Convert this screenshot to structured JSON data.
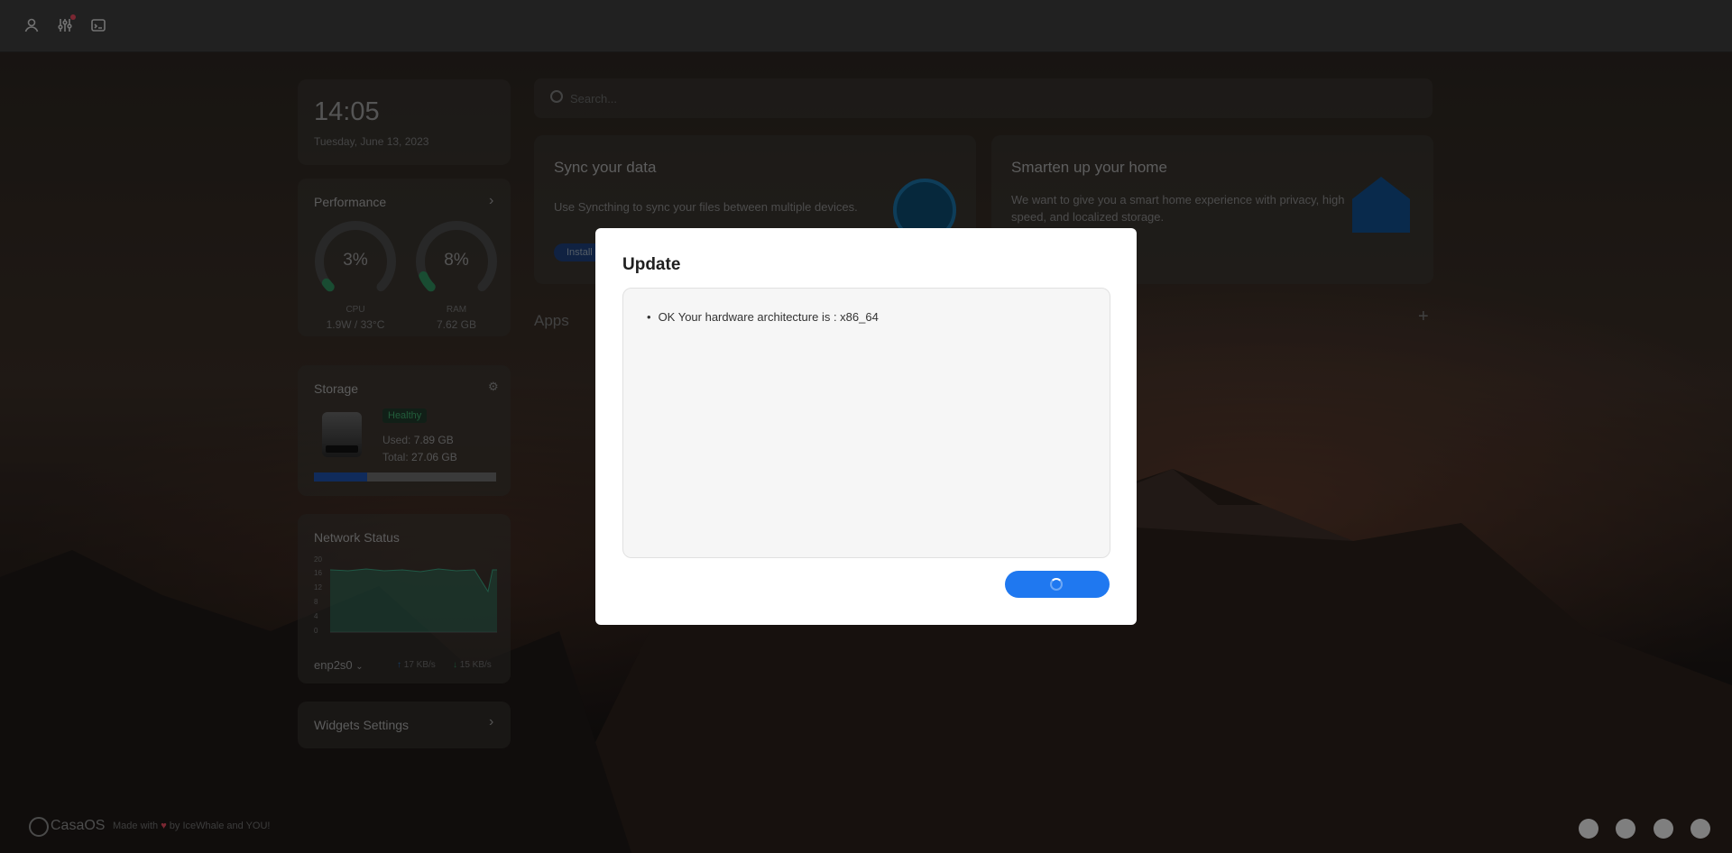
{
  "clock": {
    "time": "14:05",
    "date": "Tuesday, June 13, 2023"
  },
  "performance": {
    "title": "Performance",
    "cpu": {
      "value": "3%",
      "label": "CPU",
      "detail": "1.9W / 33°C",
      "fraction": 0.03
    },
    "ram": {
      "value": "8%",
      "label": "RAM",
      "detail": "7.62 GB",
      "fraction": 0.08
    }
  },
  "storage": {
    "title": "Storage",
    "status": "Healthy",
    "used_label": "Used:",
    "used": "7.89 GB",
    "total_label": "Total:",
    "total": "27.06 GB",
    "used_fraction": 0.29
  },
  "network": {
    "title": "Network Status",
    "y_ticks": [
      "20",
      "16",
      "12",
      "8",
      "4",
      "0"
    ],
    "interface": "enp2s0",
    "up": "17 KB/s",
    "down": "15 KB/s"
  },
  "widgets_settings": {
    "label": "Widgets Settings"
  },
  "search": {
    "placeholder": "Search..."
  },
  "cards": [
    {
      "title": "Sync your data",
      "text": "Use Syncthing to sync your files between multiple devices.",
      "button": "Install"
    },
    {
      "title": "Smarten up your home",
      "text": "We want to give you a smart home experience with privacy, high speed, and localized storage."
    }
  ],
  "apps": {
    "title": "Apps"
  },
  "footer": {
    "brand": "CasaOS",
    "made_with": "Made with",
    "by": "by IceWhale and YOU!"
  },
  "modal": {
    "title": "Update",
    "log": [
      "OK Your hardware architecture is : x86_64"
    ]
  },
  "colors": {
    "accent": "#1f78f0",
    "healthy": "#2e8b57",
    "heart": "#e0475b"
  }
}
